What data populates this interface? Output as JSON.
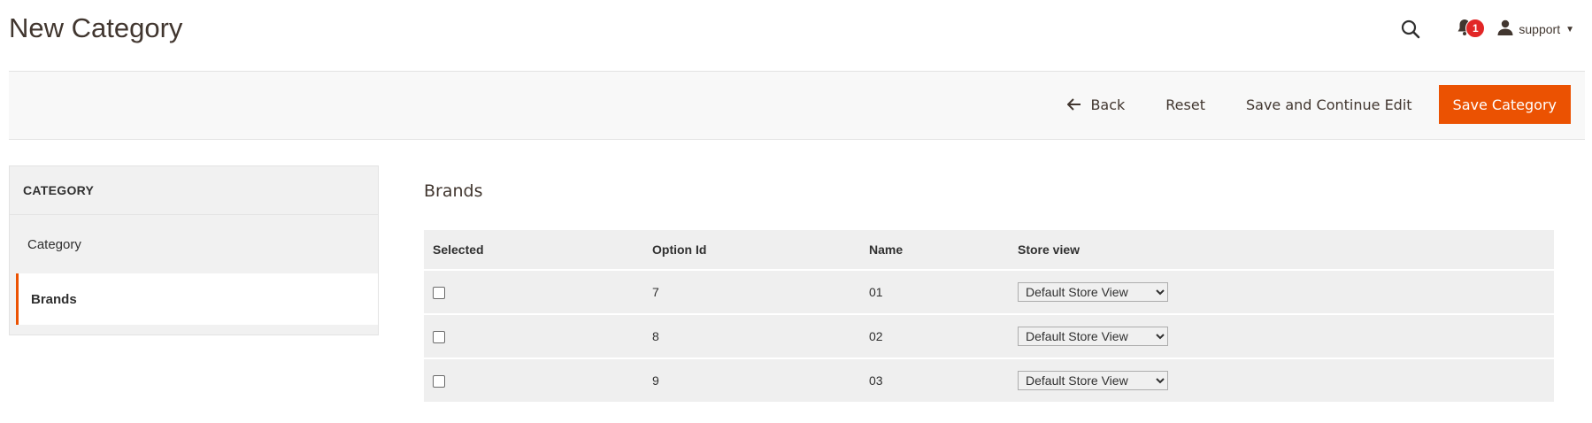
{
  "header": {
    "title": "New Category",
    "notifications_count": "1",
    "user_name": "support"
  },
  "toolbar": {
    "back_label": "Back",
    "reset_label": "Reset",
    "save_continue_label": "Save and Continue Edit",
    "save_label": "Save Category"
  },
  "sidebar": {
    "heading": "CATEGORY",
    "items": [
      {
        "label": "Category",
        "active": false
      },
      {
        "label": "Brands",
        "active": true
      }
    ]
  },
  "brands": {
    "title": "Brands",
    "columns": [
      "Selected",
      "Option Id",
      "Name",
      "Store view"
    ],
    "rows": [
      {
        "selected": false,
        "option_id": "7",
        "name": "01",
        "store_view": "Default Store View"
      },
      {
        "selected": false,
        "option_id": "8",
        "name": "02",
        "store_view": "Default Store View"
      },
      {
        "selected": false,
        "option_id": "9",
        "name": "03",
        "store_view": "Default Store View"
      }
    ]
  },
  "colors": {
    "accent": "#eb5202",
    "badge": "#e22626"
  },
  "icons": [
    "search-icon",
    "bell-icon",
    "user-icon",
    "caret-down-icon",
    "arrow-left-icon"
  ]
}
